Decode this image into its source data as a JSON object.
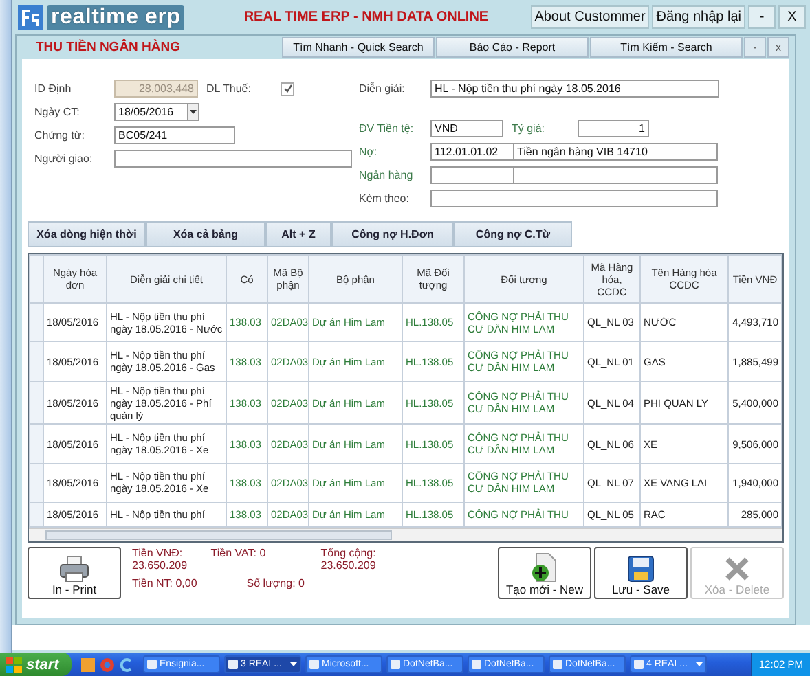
{
  "app_header": {
    "logo": "realtime erp",
    "title": "REAL TIME ERP - NMH DATA ONLINE",
    "buttons": [
      "About Custommer",
      "Đăng nhập lại",
      "-",
      "X"
    ]
  },
  "window": {
    "title": "THU TIỀN NGÂN HÀNG",
    "toolbar": [
      "Tìm Nhanh - Quick Search",
      "Báo Cáo - Report",
      "Tìm Kiếm - Search"
    ],
    "controls": [
      "-",
      "x"
    ]
  },
  "form": {
    "id": {
      "label": "ID Định",
      "value": "28,003,448",
      "disabled": true
    },
    "tax": {
      "label": "DL Thuế:",
      "checked": true
    },
    "date": {
      "label": "Ngày CT:",
      "value": "18/05/2016"
    },
    "voucher": {
      "label": "Chứng từ:",
      "value": "BC05/241"
    },
    "deliverer": {
      "label": "Người giao:"
    },
    "description": {
      "label": "Diễn giải:",
      "value": "HL - Nộp tiền thu phí ngày 18.05.2016"
    },
    "currency": {
      "label": "ĐV Tiền tệ:",
      "value": "VNĐ"
    },
    "rate": {
      "label": "Tỷ giá:",
      "value": "1"
    },
    "debit": {
      "label": "Nợ:",
      "code": "112.01.01.02",
      "name": "Tiền ngân hàng VIB 14710"
    },
    "bank": {
      "label": "Ngân hàng"
    },
    "attached": {
      "label": "Kèm theo:"
    }
  },
  "action_buttons": [
    "Xóa dòng hiện thời",
    "Xóa cả bảng",
    "Alt + Z",
    "Công nợ H.Đơn",
    "Công nợ C.Từ"
  ],
  "table": {
    "columns": [
      "Ngày hóa đơn",
      "Diễn giải chi tiết",
      "Có",
      "Mã Bộ phận",
      "Bộ phận",
      "Mã Đối tượng",
      "Đối tượng",
      "Mã Hàng hóa, CCDC",
      "Tên Hàng hóa CCDC",
      "Tiền VNĐ"
    ],
    "rows": [
      [
        "18/05/2016",
        "HL - Nộp tiền thu phí ngày 18.05.2016 - Nước",
        "138.03",
        "02DA03",
        "Dự án Him Lam",
        "HL.138.05",
        "CÔNG NỢ PHẢI THU CƯ DÂN HIM LAM",
        "QL_NL 03",
        "NƯỚC",
        "4,493,710"
      ],
      [
        "18/05/2016",
        "HL - Nộp tiền thu phí ngày 18.05.2016 - Gas",
        "138.03",
        "02DA03",
        "Dự án Him Lam",
        "HL.138.05",
        "CÔNG NỢ PHẢI THU CƯ DÂN HIM LAM",
        "QL_NL 01",
        "GAS",
        "1,885,499"
      ],
      [
        "18/05/2016",
        "HL - Nộp tiền thu phí ngày 18.05.2016 - Phí quản lý",
        "138.03",
        "02DA03",
        "Dự án Him Lam",
        "HL.138.05",
        "CÔNG NỢ PHẢI THU CƯ DÂN HIM LAM",
        "QL_NL 04",
        "PHI QUAN LY",
        "5,400,000"
      ],
      [
        "18/05/2016",
        "HL - Nộp tiền thu phí ngày 18.05.2016 - Xe",
        "138.03",
        "02DA03",
        "Dự án Him Lam",
        "HL.138.05",
        "CÔNG NỢ PHẢI THU CƯ DÂN HIM LAM",
        "QL_NL 06",
        "XE",
        "9,506,000"
      ],
      [
        "18/05/2016",
        "HL - Nộp tiền thu phí ngày 18.05.2016 - Xe",
        "138.03",
        "02DA03",
        "Dự án Him Lam",
        "HL.138.05",
        "CÔNG NỢ PHẢI THU CƯ DÂN HIM LAM",
        "QL_NL 07",
        "XE VANG LAI",
        "1,940,000"
      ],
      [
        "18/05/2016",
        "HL - Nộp tiền thu phí",
        "138.03",
        "02DA03",
        "Dự án Him Lam",
        "HL.138.05",
        "CÔNG NỢ PHẢI THU",
        "QL_NL 05",
        "RAC",
        "285,000"
      ]
    ]
  },
  "totals": {
    "vnd_label": "Tiền VNĐ:",
    "vnd": "23.650.209",
    "vat": "Tiền VAT: 0",
    "total_label": "Tổng cộng:",
    "total": "23.650.209",
    "nt": "Tiền NT: 0,00",
    "qty": "Số lượng: 0"
  },
  "buttons": [
    {
      "label": "In - Print",
      "kind": "print",
      "disabled": false
    },
    {
      "label": "Tạo mới - New",
      "kind": "new",
      "disabled": false
    },
    {
      "label": "Lưu - Save",
      "kind": "save",
      "disabled": false
    },
    {
      "label": "Xóa - Delete",
      "kind": "delete",
      "disabled": true
    }
  ],
  "taskbar": {
    "start": "start",
    "tasks": [
      {
        "label": "Ensignia...",
        "selected": false,
        "grouped": false
      },
      {
        "label": "3 REAL...",
        "selected": true,
        "grouped": true
      },
      {
        "label": "Microsoft...",
        "selected": false,
        "grouped": false
      },
      {
        "label": "DotNetBa...",
        "selected": false,
        "grouped": false
      },
      {
        "label": "DotNetBa...",
        "selected": false,
        "grouped": false
      },
      {
        "label": "DotNetBa...",
        "selected": false,
        "grouped": false
      },
      {
        "label": "4 REAL...",
        "selected": false,
        "grouped": true
      }
    ],
    "clock": "12:02 PM"
  }
}
